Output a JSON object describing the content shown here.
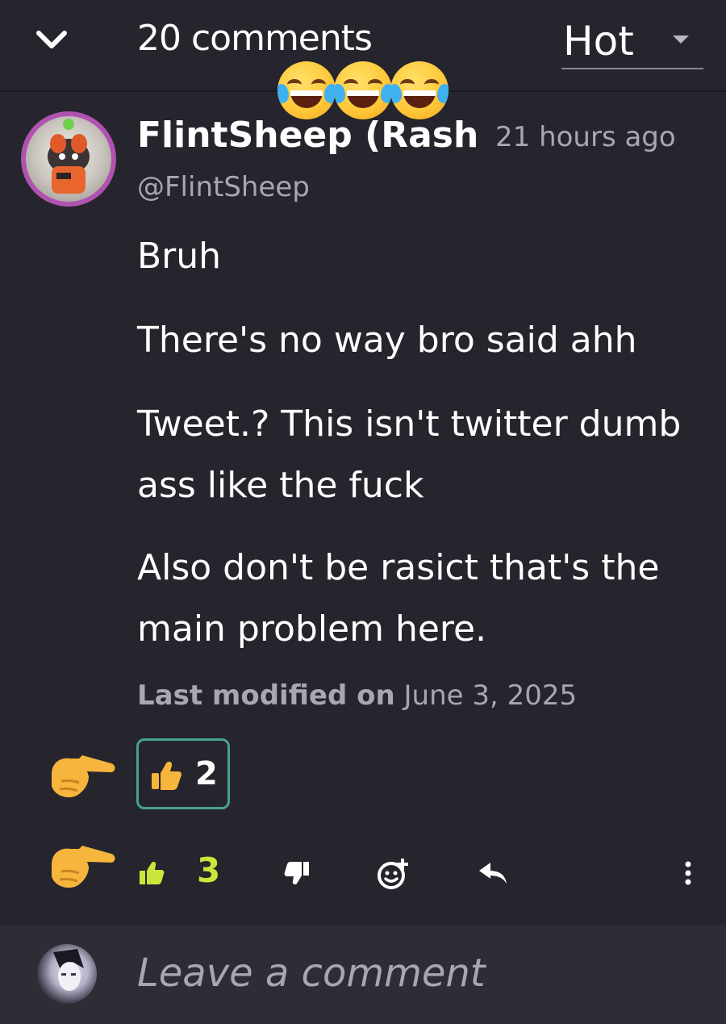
{
  "header": {
    "comment_count": "20 comments",
    "sort_label": "Hot"
  },
  "comment": {
    "author_name": "FlintSheep (Rash",
    "timestamp": "21 hours ago",
    "handle": "@FlintSheep",
    "paragraphs": [
      "Bruh",
      "There's no way bro said ahh",
      "Tweet.? This isn't twitter dumb ass like the fuck",
      "Also don't be rasict that's the main problem here."
    ],
    "modified_prefix": "Last modified on",
    "modified_date": "June 3, 2025",
    "reaction_count": "2",
    "like_count": "3"
  },
  "composer": {
    "placeholder": "Leave a comment"
  },
  "overlay": {
    "emoji": "face-with-tears-of-joy",
    "count": 3
  },
  "colors": {
    "background": "#26252d",
    "footer": "#2e2d35",
    "secondary_text": "#a8a6b0",
    "like_green": "#c8e73a",
    "reaction_border": "#47a28c",
    "avatar_ring": "#b053b0"
  }
}
